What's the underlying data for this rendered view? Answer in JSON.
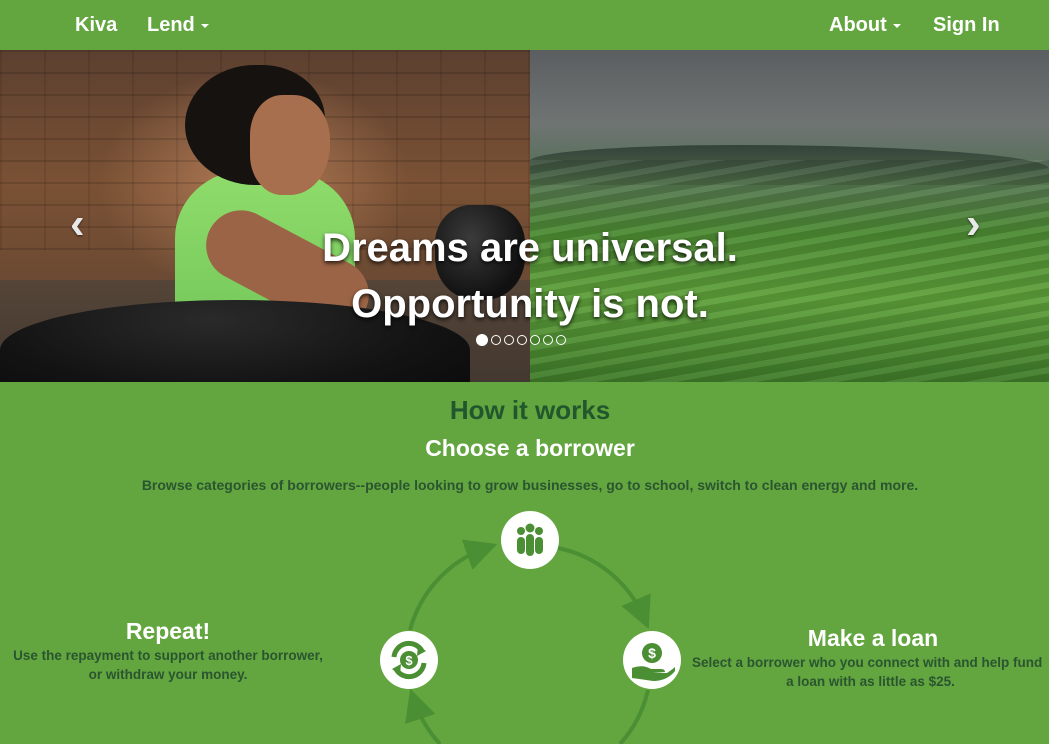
{
  "nav": {
    "brand": "Kiva",
    "lend": "Lend",
    "about": "About",
    "sign_in": "Sign In"
  },
  "hero": {
    "line1": "Dreams are universal.",
    "line2": "Opportunity is not.",
    "prev_glyph": "‹",
    "next_glyph": "›",
    "indicator_count": 7,
    "active_indicator": 1
  },
  "how": {
    "title": "How it works",
    "choose_title": "Choose a borrower",
    "choose_desc": "Browse categories of borrowers--people looking to grow businesses, go to school, switch to clean energy and more.",
    "repeat_title": "Repeat!",
    "repeat_desc_1": "Use the repayment to support another borrower,",
    "repeat_desc_2": "or withdraw your money.",
    "loan_title": "Make a loan",
    "loan_desc_1": "Select a borrower who you connect with and help fund",
    "loan_desc_2": "a loan with as little as $25."
  },
  "colors": {
    "brand_green": "#63a63f",
    "dark_green": "#22572d",
    "icon_green": "#4a8f33"
  },
  "icons": {
    "borrowers": "people-group-icon",
    "loan": "hand-dollar-icon",
    "repeat": "refresh-dollar-icon"
  }
}
